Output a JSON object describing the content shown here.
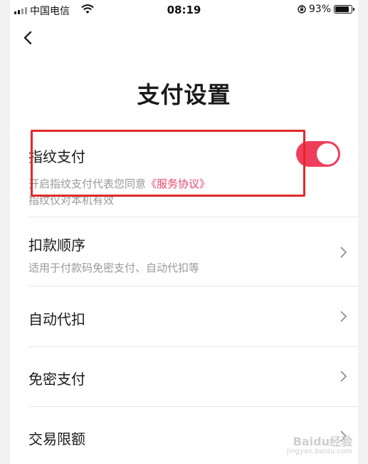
{
  "status_bar": {
    "carrier": "中国电信",
    "time": "08:19",
    "battery": "93%",
    "battery_level": 0.93
  },
  "page": {
    "title": "支付设置"
  },
  "settings": {
    "fingerprint": {
      "label": "指纹支付",
      "desc_prefix": "开启指纹支付代表您同意",
      "agreement_link": "《服务协议》",
      "desc_line2": "指纹仅对本机有效",
      "enabled": true
    },
    "deduction_order": {
      "label": "扣款顺序",
      "desc": "适用于付款码免密支付、自动代扣等"
    },
    "auto_deduct": {
      "label": "自动代扣"
    },
    "password_free": {
      "label": "免密支付"
    },
    "trade_limit": {
      "label": "交易限额"
    }
  },
  "watermark": {
    "text": "Baidu经验",
    "url": "jingyan.baidu.com"
  },
  "colors": {
    "accent": "#ef3d5b",
    "link": "#e8456b",
    "highlight": "#e02a2a"
  }
}
